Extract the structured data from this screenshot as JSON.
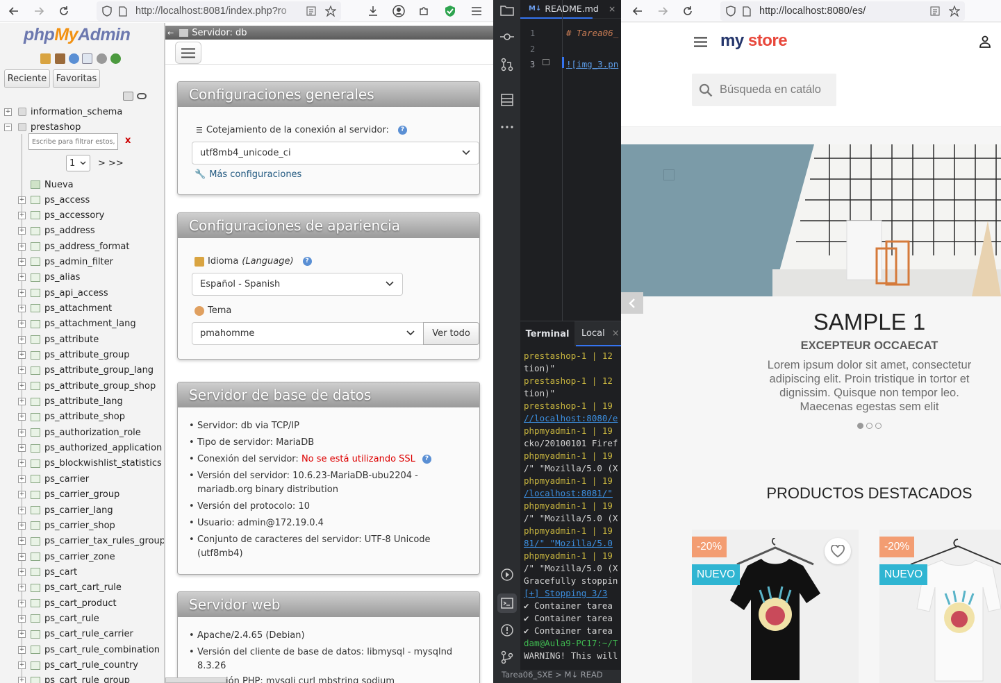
{
  "left_browser": {
    "url_host": "http://localhost:8081/index.php?r",
    "url_rest": "o"
  },
  "pma_nav": {
    "logo_php": "php",
    "logo_my": "My",
    "logo_admin": "Admin",
    "tab_recent": "Reciente",
    "tab_favorites": "Favoritas",
    "databases": [
      "information_schema",
      "prestashop"
    ],
    "filter_placeholder": "Escribe para filtrar estos, Enter para buscar todos",
    "filter_clear": "x",
    "page_select": "1",
    "page_next": "> >>",
    "new_label": "Nueva",
    "tables": [
      "ps_access",
      "ps_accessory",
      "ps_address",
      "ps_address_format",
      "ps_admin_filter",
      "ps_alias",
      "ps_api_access",
      "ps_attachment",
      "ps_attachment_lang",
      "ps_attribute",
      "ps_attribute_group",
      "ps_attribute_group_lang",
      "ps_attribute_group_shop",
      "ps_attribute_lang",
      "ps_attribute_shop",
      "ps_authorization_role",
      "ps_authorized_application",
      "ps_blockwishlist_statistics",
      "ps_carrier",
      "ps_carrier_group",
      "ps_carrier_lang",
      "ps_carrier_shop",
      "ps_carrier_tax_rules_group",
      "ps_carrier_zone",
      "ps_cart",
      "ps_cart_cart_rule",
      "ps_cart_product",
      "ps_cart_rule",
      "ps_cart_rule_carrier",
      "ps_cart_rule_combination",
      "ps_cart_rule_country",
      "ps_cart_rule_group"
    ]
  },
  "pma_main": {
    "server_title": "Servidor: db",
    "general": {
      "title": "Configuraciones generales",
      "collation_label": "Cotejamiento de la conexión al servidor:",
      "collation_value": "utf8mb4_unicode_ci",
      "more_settings": "Más configuraciones"
    },
    "appearance": {
      "title": "Configuraciones de apariencia",
      "language_label": "Idioma",
      "language_label_en": "(Language)",
      "language_value": "Español - Spanish",
      "theme_label": "Tema",
      "theme_value": "pmahomme",
      "view_all": "Ver todo"
    },
    "db_server": {
      "title": "Servidor de base de datos",
      "server": "Servidor: db via TCP/IP",
      "type": "Tipo de servidor: MariaDB",
      "conn_label": "Conexión del servidor:",
      "conn_value": "No se está utilizando SSL",
      "version_1": "Versión del servidor: 10.6.23-MariaDB-ubu2204 -",
      "version_2": "mariadb.org binary distribution",
      "protocol": "Versión del protocolo: 10",
      "user": "Usuario: admin@172.19.0.4",
      "charset_1": "Conjunto de caracteres del servidor: UTF-8 Unicode",
      "charset_2": "(utf8mb4)"
    },
    "web_server": {
      "title": "Servidor web",
      "apache": "Apache/2.4.65 (Debian)",
      "client_1": "Versión del cliente de base de datos: libmysql - mysqlnd",
      "client_2": "8.3.26",
      "php_ext": "ensión PHP: mysqli  curl  mbstring  sodium"
    }
  },
  "vscode": {
    "tab_name": "README.md",
    "tab_close": "×",
    "lines": [
      "1",
      "2",
      "3"
    ],
    "line1": "# Tarea06_",
    "line3": "![img_3.pn",
    "terminal_tab": "Terminal",
    "local_tab": "Local",
    "local_close": "×",
    "status": "Tarea06_SXE  >  M↓ READ",
    "term": [
      {
        "c": "y",
        "t": "prestashop-1  | 12"
      },
      {
        "c": "w",
        "t": "tion)\""
      },
      {
        "c": "y",
        "t": "prestashop-1  | 12"
      },
      {
        "c": "w",
        "t": "tion)\""
      },
      {
        "c": "y",
        "t": "prestashop-1  | 19"
      },
      {
        "c": "u",
        "t": "//localhost:8080/e"
      },
      {
        "c": "y",
        "t": "phpmyadmin-1  | 19"
      },
      {
        "c": "w",
        "t": "cko/20100101 Firef"
      },
      {
        "c": "y",
        "t": "phpmyadmin-1  | 19"
      },
      {
        "c": "w",
        "t": "/\" \"Mozilla/5.0 (X"
      },
      {
        "c": "y",
        "t": "phpmyadmin-1  | 19"
      },
      {
        "c": "u",
        "t": "/localhost:8081/\""
      },
      {
        "c": "y",
        "t": "phpmyadmin-1  | 19"
      },
      {
        "c": "w",
        "t": "/\" \"Mozilla/5.0 (X"
      },
      {
        "c": "y",
        "t": "phpmyadmin-1  | 19"
      },
      {
        "c": "u",
        "t": "81/\" \"Mozilla/5.0"
      },
      {
        "c": "y",
        "t": "phpmyadmin-1  | 19"
      },
      {
        "c": "w",
        "t": "/\" \"Mozilla/5.0 (X"
      },
      {
        "c": "w",
        "t": "Gracefully stoppin"
      },
      {
        "c": "u",
        "t": "[+] Stopping 3/3"
      },
      {
        "c": "w",
        "t": " ✔ Container tarea"
      },
      {
        "c": "w",
        "t": " ✔ Container tarea"
      },
      {
        "c": "w",
        "t": " ✔ Container tarea"
      },
      {
        "c": "g",
        "t": "dam@Aula9-PC17:~/T"
      },
      {
        "c": "w",
        "t": "WARNING! This will"
      }
    ]
  },
  "right_browser": {
    "url": "http://localhost:8080/es/",
    "logo_my": "my",
    "logo_store": "store",
    "search_placeholder": "Búsqueda en catálo",
    "slide_title": "SAMPLE 1",
    "slide_subtitle": "EXCEPTEUR OCCAECAT",
    "slide_text": "Lorem ipsum dolor sit amet, consectetur adipiscing elit. Proin tristique in tortor et dignissim. Quisque non tempor leo. Maecenas egestas sem elit",
    "featured_title": "PRODUCTOS DESTACADOS",
    "discount_1": "-20%",
    "new_1": "NUEVO",
    "discount_2": "-20%",
    "new_2": "NUEVO"
  }
}
